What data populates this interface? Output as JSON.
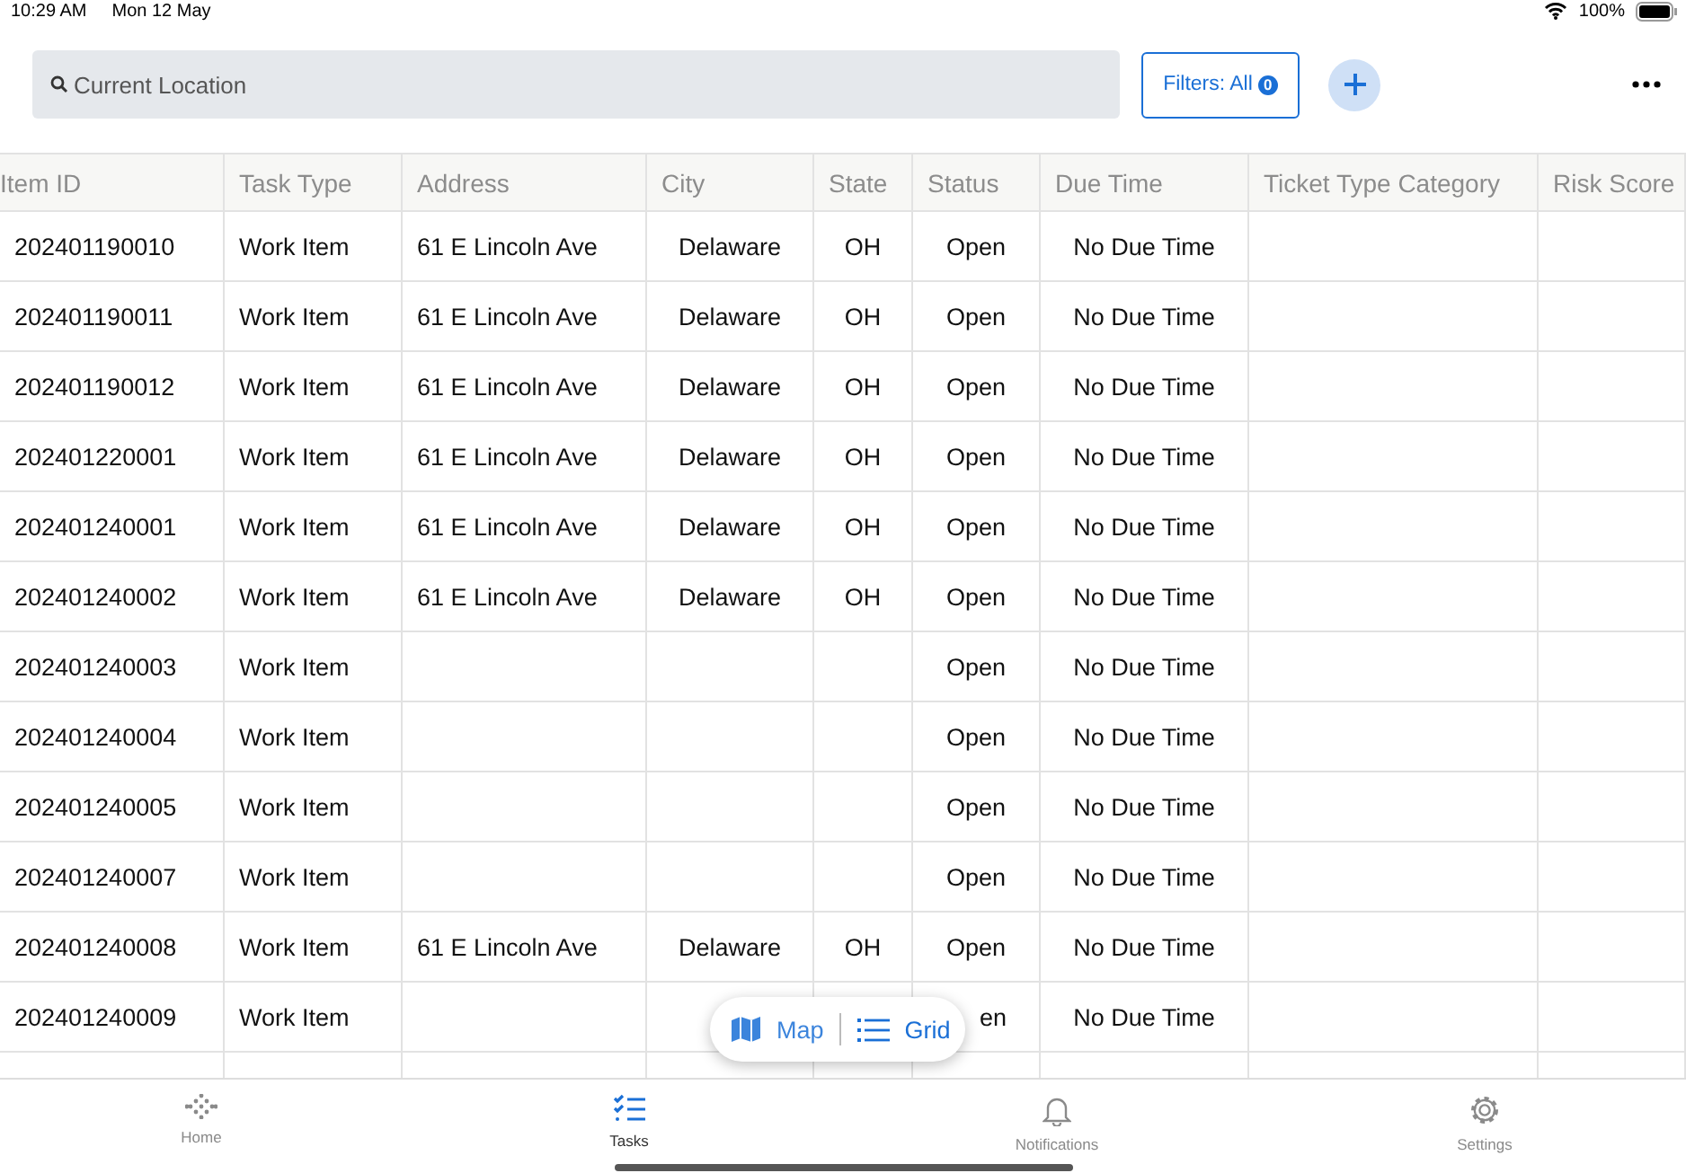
{
  "status_bar": {
    "time": "10:29 AM",
    "date": "Mon 12 May",
    "battery": "100%"
  },
  "search": {
    "placeholder": "Current Location"
  },
  "filters_button": {
    "label": "Filters: All",
    "count": "0"
  },
  "table": {
    "columns": [
      "Item ID",
      "Task Type",
      "Address",
      "City",
      "State",
      "Status",
      "Due Time",
      "Ticket Type Category",
      "Risk Score"
    ],
    "rows": [
      {
        "cells": [
          "202401190010",
          "Work Item",
          "61 E Lincoln Ave",
          "Delaware",
          "OH",
          "Open",
          "No Due Time",
          "",
          ""
        ]
      },
      {
        "cells": [
          "202401190011",
          "Work Item",
          "61 E Lincoln Ave",
          "Delaware",
          "OH",
          "Open",
          "No Due Time",
          "",
          ""
        ]
      },
      {
        "cells": [
          "202401190012",
          "Work Item",
          "61 E Lincoln Ave",
          "Delaware",
          "OH",
          "Open",
          "No Due Time",
          "",
          ""
        ]
      },
      {
        "cells": [
          "202401220001",
          "Work Item",
          "61 E Lincoln Ave",
          "Delaware",
          "OH",
          "Open",
          "No Due Time",
          "",
          ""
        ]
      },
      {
        "cells": [
          "202401240001",
          "Work Item",
          "61 E Lincoln Ave",
          "Delaware",
          "OH",
          "Open",
          "No Due Time",
          "",
          ""
        ]
      },
      {
        "cells": [
          "202401240002",
          "Work Item",
          "61 E Lincoln Ave",
          "Delaware",
          "OH",
          "Open",
          "No Due Time",
          "",
          ""
        ]
      },
      {
        "cells": [
          "202401240003",
          "Work Item",
          "",
          "",
          "",
          "Open",
          "No Due Time",
          "",
          ""
        ]
      },
      {
        "cells": [
          "202401240004",
          "Work Item",
          "",
          "",
          "",
          "Open",
          "No Due Time",
          "",
          ""
        ]
      },
      {
        "cells": [
          "202401240005",
          "Work Item",
          "",
          "",
          "",
          "Open",
          "No Due Time",
          "",
          ""
        ]
      },
      {
        "cells": [
          "202401240007",
          "Work Item",
          "",
          "",
          "",
          "Open",
          "No Due Time",
          "",
          ""
        ]
      },
      {
        "cells": [
          "202401240008",
          "Work Item",
          "61 E Lincoln Ave",
          "Delaware",
          "OH",
          "Open",
          "No Due Time",
          "",
          ""
        ]
      },
      {
        "cells": [
          "202401240009",
          "Work Item",
          "",
          "",
          "",
          "en",
          "No Due Time",
          "",
          ""
        ],
        "partly_covered": true
      }
    ]
  },
  "view_toggle": [
    {
      "label": "Map",
      "kind": "map",
      "selected": false
    },
    {
      "label": "Grid",
      "kind": "grid",
      "selected": true
    }
  ],
  "tab_bar": [
    {
      "label": "Home",
      "kind": "home",
      "selected": false
    },
    {
      "label": "Tasks",
      "kind": "tasks",
      "selected": true
    },
    {
      "label": "Notifications",
      "kind": "bell",
      "selected": false
    },
    {
      "label": "Settings",
      "kind": "gear",
      "selected": false
    }
  ]
}
